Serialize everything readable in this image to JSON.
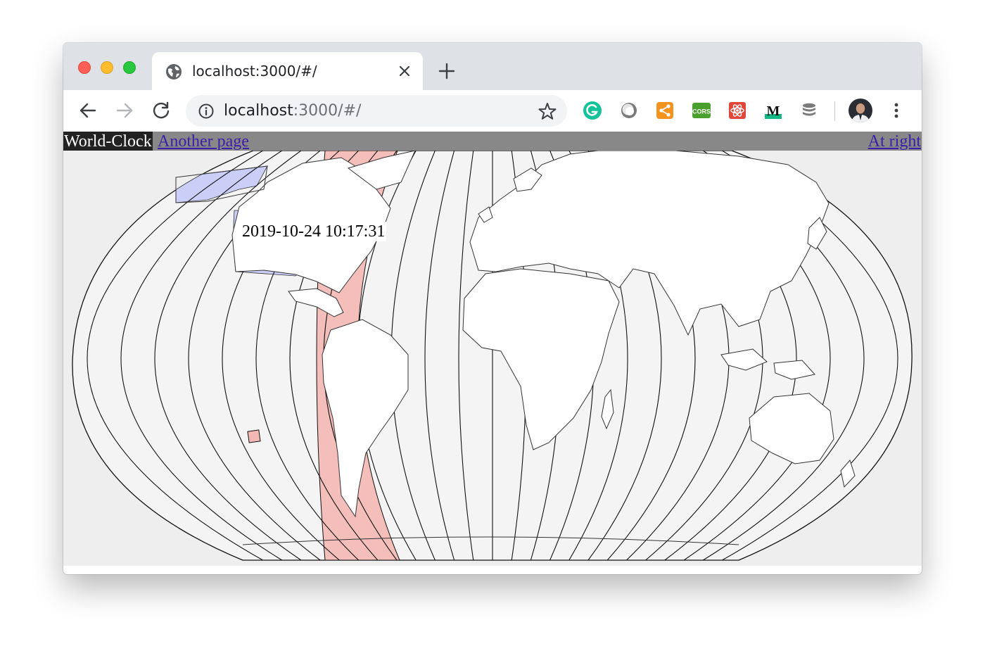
{
  "browser": {
    "tab": {
      "title": "localhost:3000/#/",
      "favicon": "globe-icon"
    },
    "address": {
      "host": "localhost",
      "rest": ":3000/#/"
    },
    "extensions": [
      "grammarly-icon",
      "sphere-extension-icon",
      "share-extension-icon",
      "cors-extension-icon",
      "react-devtools-icon",
      "medium-extension-icon",
      "database-extension-icon"
    ],
    "colors": {
      "tabstrip": "#dee1e6",
      "omnibox": "#f1f3f4"
    }
  },
  "app": {
    "brand": "World-Clock",
    "nav": {
      "another_page": "Another page",
      "at_right": "At right"
    },
    "clock": {
      "datetime": "2019-10-24 10:17:31"
    },
    "colors": {
      "navbar": "#888888",
      "brand_bg": "#222222",
      "highlight_zone": "#f4b8b4",
      "selected_region": "#c8ccf8",
      "map_ocean": "#eeeeee"
    }
  }
}
